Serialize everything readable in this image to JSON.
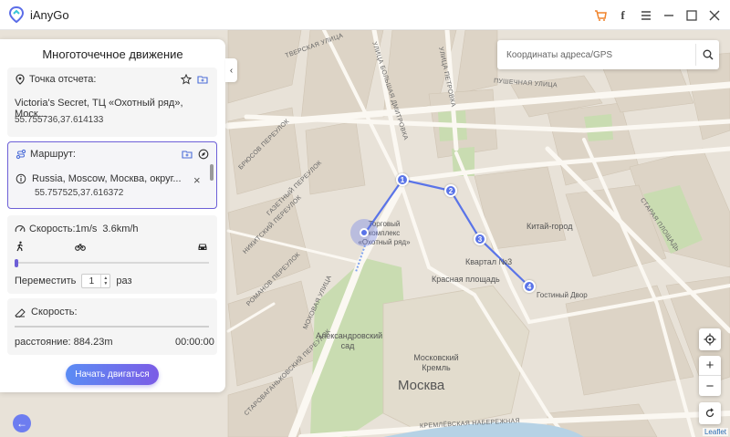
{
  "app": {
    "title": "iAnyGo"
  },
  "titlebar_icons": [
    "cart-icon",
    "facebook-icon",
    "menu-icon",
    "minimize-icon",
    "maximize-icon",
    "close-icon"
  ],
  "panel": {
    "title": "Многоточечное движение",
    "origin": {
      "label": "Точка отсчета:",
      "address": "Victoria's Secret, ТЦ «Охотный ряд», Моск...",
      "coords": "55.755736,37.614133"
    },
    "route": {
      "label": "Маршрут:",
      "item_address": "Russia, Moscow, Москва, округ...",
      "item_coords": "55.757525,37.616372"
    },
    "speed": {
      "label": "Скорость:1m/s",
      "kmh": "3.6km/h",
      "repeat_label": "Переместить",
      "repeat_value": "1",
      "repeat_unit": "раз"
    },
    "stats": {
      "label": "Скорость:",
      "distance": "расстояние: 884.23m",
      "time": "00:00:00"
    },
    "start_button": "Начать двигаться"
  },
  "search": {
    "placeholder": "Координаты адреса/GPS"
  },
  "map": {
    "attribution": "Leaflet",
    "labels": {
      "tverskaya": "ТВЕРСКАЯ УЛИЦА",
      "petrovka": "УЛИЦА ПЕТРОВКА",
      "bolshaya_dmitrovka": "УЛИЦА БОЛЬШАЯ ДМИТРОВКА",
      "pushechnaya": "ПУШЕЧНАЯ УЛИЦА",
      "bryusov": "БРЮСОВ ПЕРЕУЛОК",
      "gazetny": "ГАЗЕТНЫЙ ПЕРЕУЛОК",
      "nikitsky": "НИКИТСКИЙ ПЕРЕУЛОК",
      "starая_ploshchad": "СТАРАЯ ПЛОЩАДЬ",
      "mokhovaya": "МОХОВАЯ УЛИЦА",
      "romanov": "РОМАНОВ ПЕРЕУЛОК",
      "starovagankovsky": "СТАРОВАГАНЬКОВСКИЙ ПЕРЕУЛОК",
      "mall": "Торговый комплекс «Охотный ряд»",
      "kitay_gorod": "Китай-город",
      "kvartal": "Квартал №3",
      "red_square": "Красная площадь",
      "gostiny_dvor": "Гостиный Двор",
      "alexander_garden": "Александровский сад",
      "kremlin": "Московский Кремль",
      "moscow": "Москва",
      "embankment": "КРЕМЛЁВСКАЯ НАБЕРЕЖНАЯ"
    },
    "waypoints": [
      "1",
      "2",
      "3",
      "4"
    ]
  }
}
